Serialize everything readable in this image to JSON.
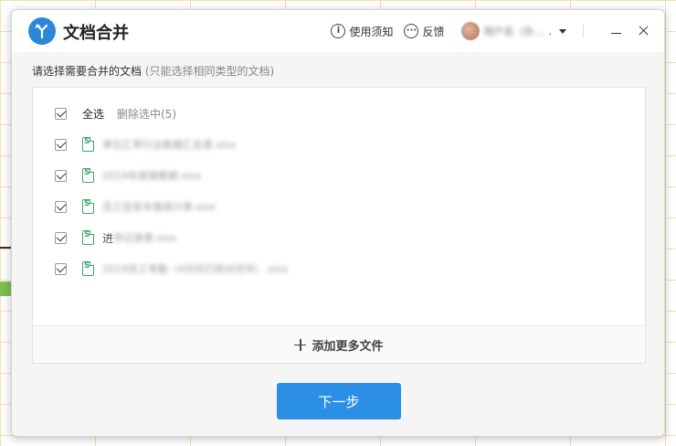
{
  "window": {
    "title": "文档合并",
    "help_label": "使用须知",
    "feedback_label": "反馈",
    "user_name": "用户名（办…",
    "user_suffix": "."
  },
  "instruction": {
    "main": "请选择需要合并的文档",
    "hint": "(只能选择相同类型的文档)"
  },
  "select_all": {
    "label": "全选",
    "delete_label": "删除选中(5)"
  },
  "files": [
    {
      "name": "单位汇率行业数据汇总表.xlsx"
    },
    {
      "name": "2019年度销售额.xlsx"
    },
    {
      "name": "员工信息年度统计表.xlsx"
    },
    {
      "name_first": "进",
      "name_rest": "货记录表.xlsx"
    },
    {
      "name": "2019员工考勤（4月份已核对完毕）.xlsx"
    }
  ],
  "add_more_label": "添加更多文件",
  "next_label": "下一步",
  "colors": {
    "accent": "#2b8fe6",
    "sheet_icon": "#3fa56a"
  }
}
